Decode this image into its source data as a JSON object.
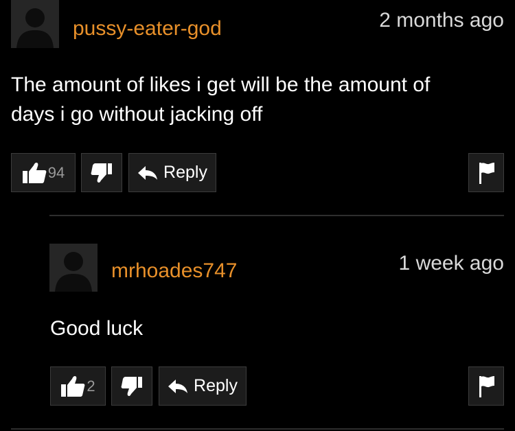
{
  "comments": [
    {
      "username": "pussy-eater-god",
      "time_ago": "2 months ago",
      "text": "The amount of likes i get will be the amount of days i go without jacking off",
      "likes": "94",
      "reply_label": "Reply"
    },
    {
      "username": "mrhoades747",
      "time_ago": "1 week ago",
      "text": "Good luck",
      "likes": "2",
      "reply_label": "Reply"
    }
  ],
  "colors": {
    "background": "#000000",
    "username": "#e8902a",
    "button_bg": "#1c1c1c",
    "button_border": "#3c3c3c",
    "muted_text": "#9a9a9a"
  },
  "icons": {
    "avatar": "default-user-silhouette-icon",
    "like": "thumbs-up-icon",
    "dislike": "thumbs-down-icon",
    "reply": "reply-arrow-icon",
    "flag": "flag-icon"
  }
}
